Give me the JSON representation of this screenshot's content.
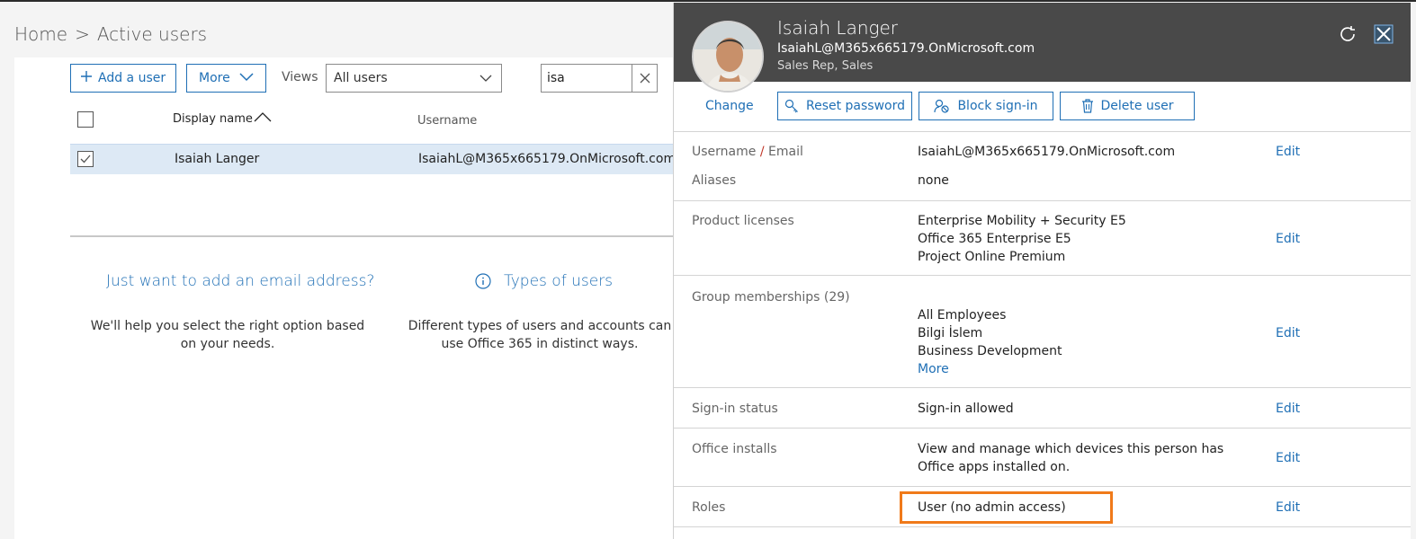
{
  "breadcrumb": {
    "home": "Home",
    "separator": ">",
    "current": "Active users"
  },
  "toolbar": {
    "add_user_label": "Add a user",
    "more_label": "More",
    "views_label": "Views",
    "views_selected": "All users",
    "search_value": "isa"
  },
  "table": {
    "columns": [
      "Display name",
      "Username"
    ],
    "rows": [
      {
        "display_name": "Isaiah Langer",
        "username": "IsaiahL@M365x665179.OnMicrosoft.com",
        "checked": true
      }
    ]
  },
  "help": {
    "email_title": "Just want to add an email address?",
    "email_text": "We'll help you select the right option based on your needs.",
    "types_title": "Types of users",
    "types_text": "Different types of users and accounts can use Office 365 in distinct ways."
  },
  "panel": {
    "name": "Isaiah Langer",
    "email": "IsaiahL@M365x665179.OnMicrosoft.com",
    "title": "Sales Rep, Sales",
    "change_label": "Change",
    "actions": {
      "reset_password": "Reset password",
      "block_signin": "Block sign-in",
      "delete_user": "Delete user"
    },
    "edit_label": "Edit",
    "fields": {
      "username_label": "Username",
      "email_label": "Email",
      "username_value": "IsaiahL@M365x665179.OnMicrosoft.com",
      "aliases_label": "Aliases",
      "aliases_value": "none",
      "licenses_label": "Product licenses",
      "licenses": [
        "Enterprise Mobility + Security E5",
        "Office 365 Enterprise E5",
        "Project Online Premium"
      ],
      "groups_label": "Group memberships (29)",
      "groups": [
        "All Employees",
        "Bilgi İslem",
        "Business Development"
      ],
      "groups_more": "More",
      "signin_label": "Sign-in status",
      "signin_value": "Sign-in allowed",
      "installs_label": "Office installs",
      "installs_value_line1": "View and manage which devices this person has",
      "installs_value_line2": "Office apps installed on.",
      "roles_label": "Roles",
      "roles_value": "User (no admin access)"
    }
  },
  "colors": {
    "accent": "#1f6fb5",
    "header_bg": "#494949",
    "highlight": "#f07a1a",
    "selected_row": "#dde9f5"
  }
}
